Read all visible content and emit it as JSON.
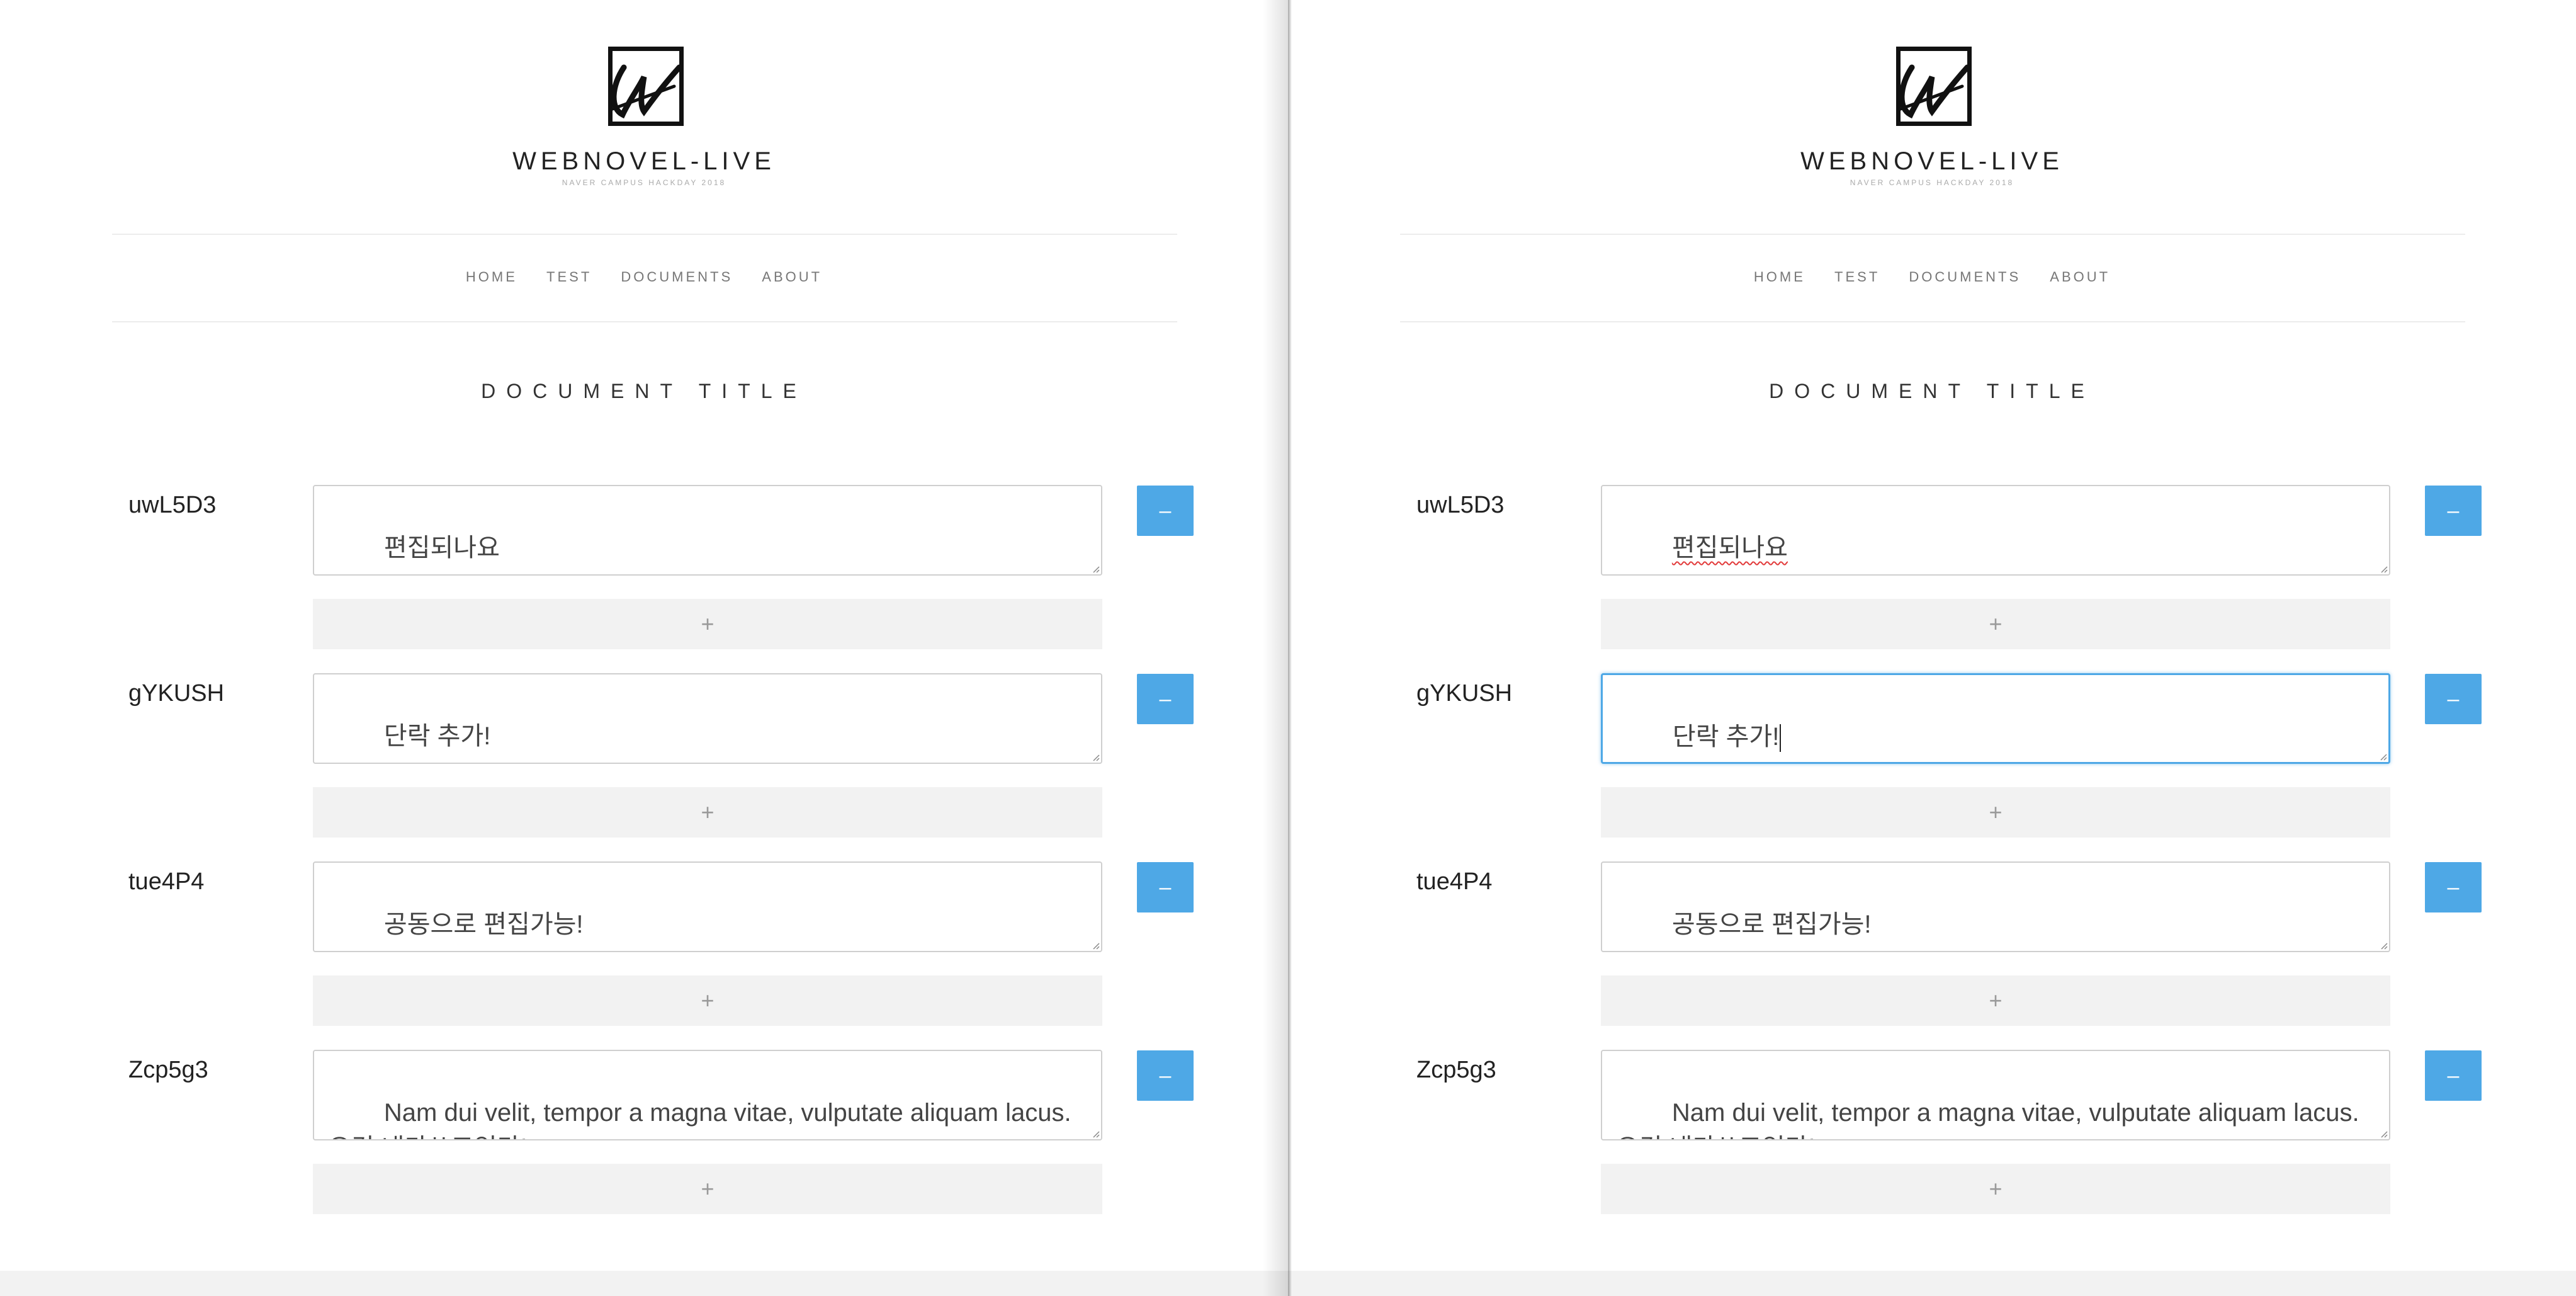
{
  "brand": {
    "name": "WEBNOVEL-LIVE",
    "subtitle": "NAVER CAMPUS HACKDAY 2018"
  },
  "nav": {
    "items": [
      "HOME",
      "TEST",
      "DOCUMENTS",
      "ABOUT"
    ]
  },
  "document": {
    "title": "DOCUMENT TITLE"
  },
  "controls": {
    "remove_label": "–",
    "add_label": "+"
  },
  "colors": {
    "accent": "#4ea8e6",
    "add_bar": "#f2f2f2",
    "spellcheck": "#e23b3b"
  },
  "left_pane": {
    "paragraphs": [
      {
        "id": "uwL5D3",
        "text": "편집되나요"
      },
      {
        "id": "gYKUSH",
        "text": "단락 추가!"
      },
      {
        "id": "tue4P4",
        "text": "공동으로 편집가능!"
      },
      {
        "id": "Zcp5g3",
        "text": "Nam dui velit, tempor a magna vitae, vulputate aliquam lacus.\n요건 내가쓰고있다!"
      }
    ]
  },
  "right_pane": {
    "focused_paragraph": "gYKUSH",
    "paragraphs": [
      {
        "id": "uwL5D3",
        "text": "편집되나요"
      },
      {
        "id": "gYKUSH",
        "text": "단락 추가!"
      },
      {
        "id": "tue4P4",
        "text": "공동으로 편집가능!"
      },
      {
        "id": "Zcp5g3",
        "text": "Nam dui velit, tempor a magna vitae, vulputate aliquam lacus.\n요건 내가쓰고있다!"
      }
    ]
  }
}
